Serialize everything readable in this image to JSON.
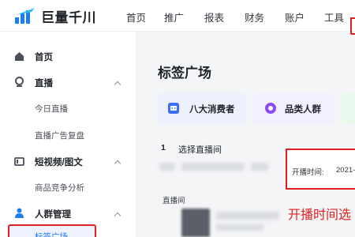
{
  "app": {
    "brand": "巨量千川"
  },
  "topnav": {
    "items": [
      {
        "label": "首页"
      },
      {
        "label": "推广"
      },
      {
        "label": "报表"
      },
      {
        "label": "财务"
      },
      {
        "label": "账户"
      },
      {
        "label": "工具"
      }
    ]
  },
  "sidebar": {
    "groups": [
      {
        "label": "首页",
        "icon": "home-icon"
      },
      {
        "label": "直播",
        "icon": "live-icon",
        "children": [
          "今日直播",
          "直播广告复盘"
        ]
      },
      {
        "label": "短视频/图文",
        "icon": "video-icon",
        "children": [
          "商品竞争分析"
        ]
      },
      {
        "label": "人群管理",
        "icon": "user-icon",
        "children": [
          "标签广场"
        ]
      }
    ]
  },
  "main": {
    "title": "标签广场",
    "cards": [
      {
        "label": "八大消费者",
        "icon": "android-robot-icon"
      },
      {
        "label": "品类人群",
        "icon": "category-circle-icon"
      }
    ],
    "step": {
      "number": "1",
      "label": "选择直播间"
    },
    "time_filter": {
      "label": "开播时间:",
      "value": "2021-"
    },
    "room_label": "直播间",
    "annotation": "开播时间选"
  },
  "colors": {
    "highlight_red": "#e02020",
    "brand_blue": "#1e7cf2",
    "card_blue_bg": "#eef1fb",
    "card_purple_bg": "#f4efff",
    "card_green_bg": "#ebf8ee"
  }
}
